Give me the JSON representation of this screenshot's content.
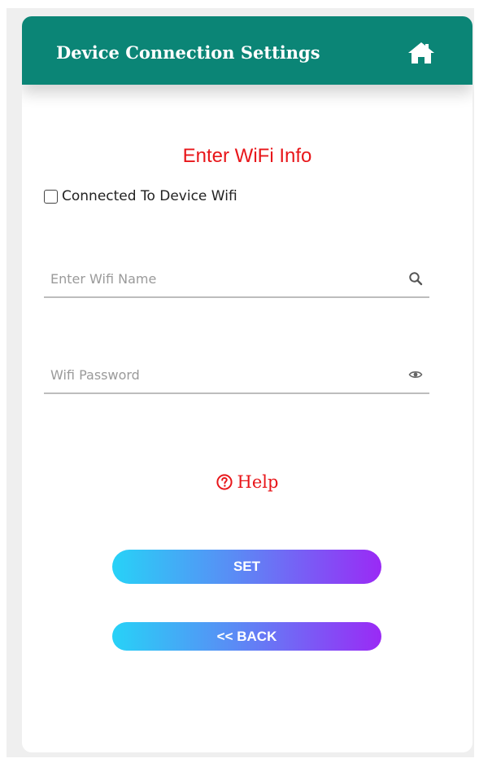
{
  "header": {
    "title": "Device Connection Settings",
    "home_icon": "home-icon",
    "bg_color": "#0b8576"
  },
  "form": {
    "section_title": "Enter WiFi Info",
    "connected_checkbox": {
      "label": "Connected To Device Wifi",
      "checked": false
    },
    "wifi_name": {
      "value": "",
      "placeholder": "Enter Wifi Name",
      "icon": "search-icon"
    },
    "wifi_password": {
      "value": "",
      "placeholder": "Wifi Password",
      "icon": "eye-icon"
    },
    "help_label": "Help",
    "help_icon": "question-circle-icon",
    "accent_color": "#e8161a"
  },
  "buttons": {
    "set_label": "SET",
    "back_label": "<< BACK",
    "gradient_start": "#27d2f7",
    "gradient_end": "#9a2af5"
  }
}
